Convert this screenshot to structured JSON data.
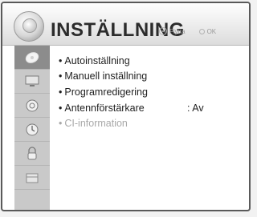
{
  "header": {
    "title": "INSTÄLLNING",
    "hint_move": "Flytta",
    "hint_ok": "OK"
  },
  "sidebar": {
    "items": [
      {
        "icon": "satellite-dish-icon",
        "active": true
      },
      {
        "icon": "monitor-icon",
        "active": false
      },
      {
        "icon": "audio-speaker-icon",
        "active": false
      },
      {
        "icon": "clock-icon",
        "active": false
      },
      {
        "icon": "lock-icon",
        "active": false
      },
      {
        "icon": "options-icon",
        "active": false
      }
    ]
  },
  "menu": {
    "items": [
      {
        "bullet": "•",
        "label": "Autoinställning",
        "value": "",
        "enabled": true
      },
      {
        "bullet": "•",
        "label": "Manuell inställning",
        "value": "",
        "enabled": true
      },
      {
        "bullet": "•",
        "label": "Programredigering",
        "value": "",
        "enabled": true
      },
      {
        "bullet": "•",
        "label": "Antennförstärkare",
        "value": ": Av",
        "enabled": true
      },
      {
        "bullet": "•",
        "label": "CI-information",
        "value": "",
        "enabled": false
      }
    ]
  },
  "colors": {
    "active_tab": "#8c8c8c",
    "sidebar": "#c9c9c9",
    "disabled_text": "#a8a8a8"
  }
}
